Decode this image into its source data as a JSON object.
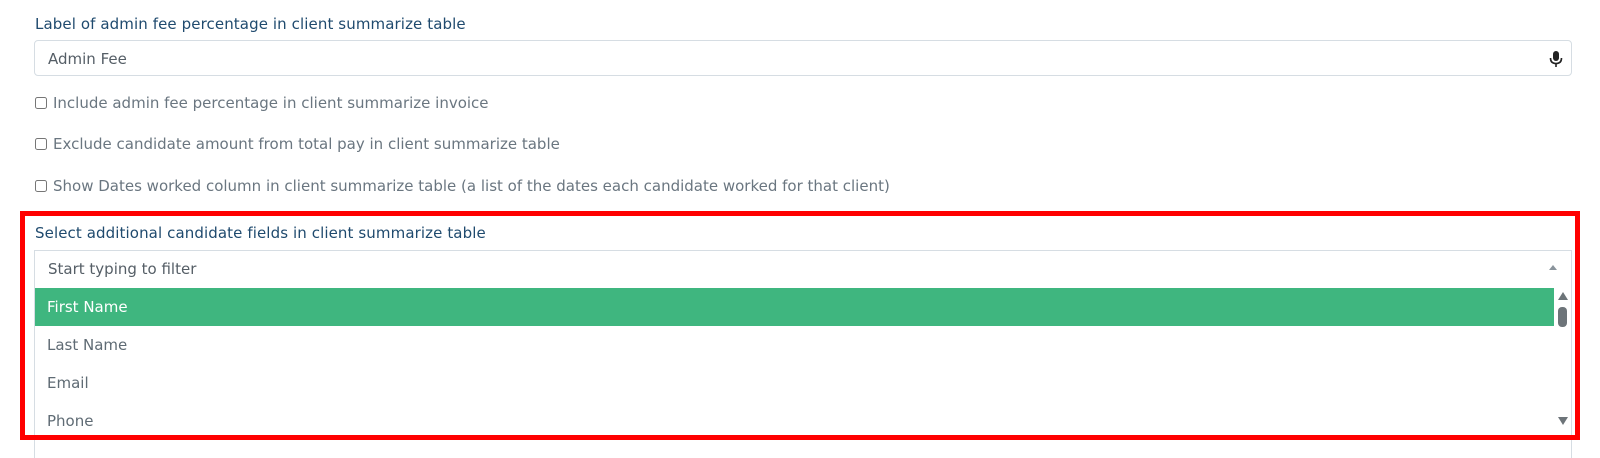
{
  "admin_fee": {
    "label": "Label of admin fee percentage in client summarize table",
    "value": "Admin Fee",
    "mic_icon": "microphone-icon"
  },
  "checkboxes": [
    {
      "label": "Include admin fee percentage in client summarize invoice",
      "checked": false
    },
    {
      "label": "Exclude candidate amount from total pay in client summarize table",
      "checked": false
    },
    {
      "label": "Show Dates worked column in client summarize table (a list of the dates each candidate worked for that client)",
      "checked": false
    }
  ],
  "candidate_fields": {
    "label": "Select additional candidate fields in client summarize table",
    "placeholder": "Start typing to filter",
    "options": [
      "First Name",
      "Last Name",
      "Email",
      "Phone"
    ],
    "highlighted_option": "First Name"
  },
  "colors": {
    "label_text": "#1f4a6e",
    "selected_option_bg": "#3fb67f",
    "highlight_border": "#ff0000"
  }
}
